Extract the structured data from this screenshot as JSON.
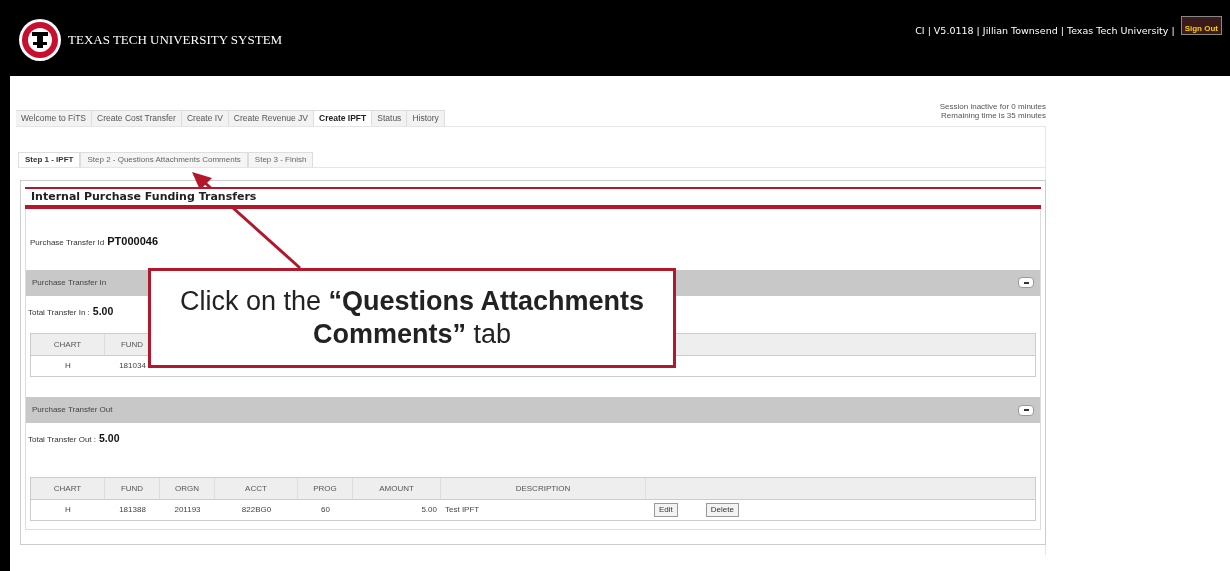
{
  "header": {
    "title": "TEXAS TECH UNIVERSITY SYSTEM",
    "user_info": "CI | V5.0118 | Jillian Townsend | Texas Tech University |",
    "sign_out": "Sign Out"
  },
  "tabs": [
    {
      "label": "Welcome to FiTS",
      "selected": false
    },
    {
      "label": "Create Cost Transfer",
      "selected": false
    },
    {
      "label": "Create IV",
      "selected": false
    },
    {
      "label": "Create Revenue JV",
      "selected": false
    },
    {
      "label": "Create IPFT",
      "selected": true
    },
    {
      "label": "Status",
      "selected": false
    },
    {
      "label": "History",
      "selected": false
    }
  ],
  "session": [
    "Session inactive for 0 minutes",
    "Remaining time is 35 minutes"
  ],
  "step_tabs": [
    {
      "label": "Step 1 - IPFT",
      "selected": true
    },
    {
      "label": "Step 2 - Questions Attachments Comments",
      "selected": false
    },
    {
      "label": "Step 3 - Finish",
      "selected": false
    }
  ],
  "panel": {
    "title": "Internal Purchase Funding Transfers",
    "id_label": "Purchase Transfer Id",
    "id_value": "PT000046"
  },
  "transfer_in": {
    "title": "Purchase Transfer In",
    "expanded": true,
    "total_label": "Total Transfer In :",
    "total": "5.00",
    "columns": [
      "CHART",
      "FUND"
    ],
    "rows": [
      [
        "H",
        "181034"
      ]
    ]
  },
  "transfer_out": {
    "title": "Purchase Transfer Out",
    "expanded": true,
    "total_label": "Total Transfer Out :",
    "total": "5.00",
    "columns": [
      "CHART",
      "FUND",
      "ORGN",
      "ACCT",
      "PROG",
      "AMOUNT",
      "DESCRIPTION"
    ],
    "rows": [
      {
        "cells": [
          "H",
          "181388",
          "201193",
          "822BG0",
          "60",
          "5.00",
          "Test IPFT"
        ],
        "actions": [
          "Edit",
          "Delete"
        ]
      }
    ]
  },
  "callout": {
    "text": "Click on the **“Questions Attachments Comments”** tab"
  }
}
